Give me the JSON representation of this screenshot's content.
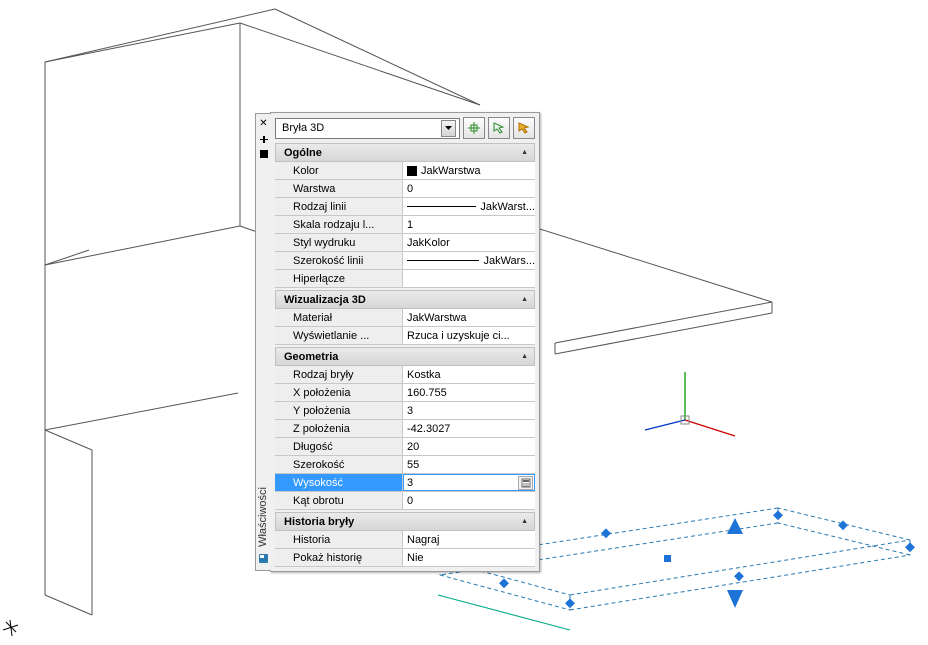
{
  "panel": {
    "side_title": "Właściwości",
    "selector": "Bryła 3D"
  },
  "sections": {
    "general": {
      "title": "Ogólne",
      "rows": {
        "color_label": "Kolor",
        "color_value": "JakWarstwa",
        "layer_label": "Warstwa",
        "layer_value": "0",
        "linetype_label": "Rodzaj linii",
        "linetype_value": "JakWarst...",
        "ltscale_label": "Skala rodzaju l...",
        "ltscale_value": "1",
        "plotstyle_label": "Styl wydruku",
        "plotstyle_value": "JakKolor",
        "lineweight_label": "Szerokość linii",
        "lineweight_value": "JakWars...",
        "hyperlink_label": "Hiperłącze",
        "hyperlink_value": ""
      }
    },
    "viz": {
      "title": "Wizualizacja 3D",
      "rows": {
        "material_label": "Materiał",
        "material_value": "JakWarstwa",
        "shadow_label": "Wyświetlanie ...",
        "shadow_value": "Rzuca i uzyskuje ci..."
      }
    },
    "geometry": {
      "title": "Geometria",
      "rows": {
        "solidtype_label": "Rodzaj bryły",
        "solidtype_value": "Kostka",
        "xpos_label": "X położenia",
        "xpos_value": "160.755",
        "ypos_label": "Y położenia",
        "ypos_value": "3",
        "zpos_label": "Z położenia",
        "zpos_value": "-42.3027",
        "length_label": "Długość",
        "length_value": "20",
        "width_label": "Szerokość",
        "width_value": "55",
        "height_label": "Wysokość",
        "height_value": "3",
        "rotation_label": "Kąt obrotu",
        "rotation_value": "0"
      }
    },
    "history": {
      "title": "Historia bryły",
      "rows": {
        "history_label": "Historia",
        "history_value": "Nagraj",
        "showhistory_label": "Pokaż historię",
        "showhistory_value": "Nie"
      }
    }
  }
}
